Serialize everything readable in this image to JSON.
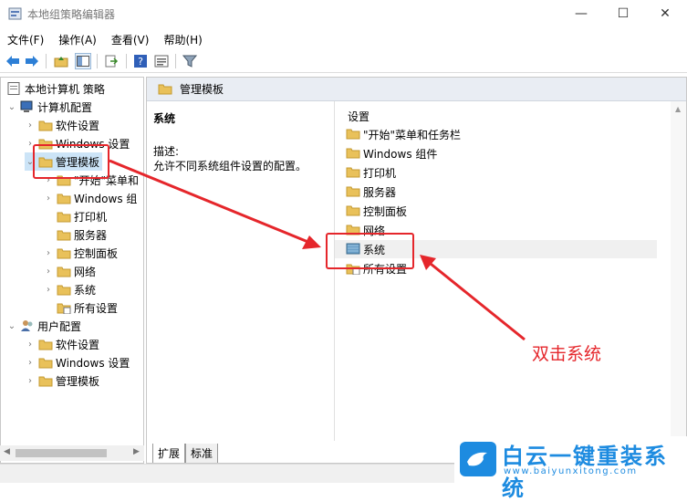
{
  "window": {
    "title": "本地组策略编辑器"
  },
  "menu": [
    "文件(F)",
    "操作(A)",
    "查看(V)",
    "帮助(H)"
  ],
  "tree": {
    "root": "本地计算机 策略",
    "computer": "计算机配置",
    "computer_children": [
      "软件设置",
      "Windows 设置",
      "管理模板"
    ],
    "admin_children": [
      "\"开始\"菜单和",
      "Windows 组",
      "打印机",
      "服务器",
      "控制面板",
      "网络",
      "系统",
      "所有设置"
    ],
    "user": "用户配置",
    "user_children": [
      "软件设置",
      "Windows 设置",
      "管理模板"
    ]
  },
  "right": {
    "header": "管理模板",
    "section_title": "系统",
    "desc_label": "描述:",
    "desc_text": "允许不同系统组件设置的配置。",
    "column_header": "设置",
    "items": [
      "\"开始\"菜单和任务栏",
      "Windows 组件",
      "打印机",
      "服务器",
      "控制面板",
      "网络",
      "系统",
      "所有设置"
    ]
  },
  "tabs": [
    "扩展",
    "标准"
  ],
  "annotation": "双击系统",
  "watermark": {
    "text": "白云一键重装系统",
    "url": "www.baiyunxitong.com"
  },
  "colors": {
    "accent_red": "#e5262b",
    "folder": "#e9c15a",
    "brand_blue": "#1d8be0"
  }
}
